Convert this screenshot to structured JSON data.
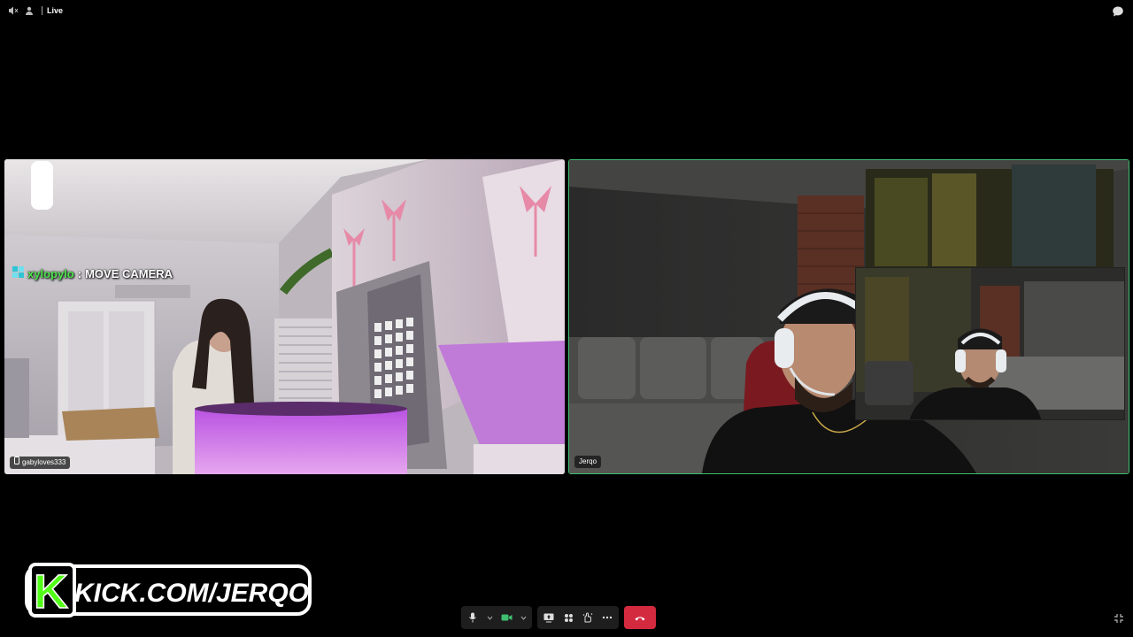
{
  "topbar": {
    "status": "Live",
    "icons": [
      "speaker-muted-icon",
      "people-icon",
      "chat-icon"
    ]
  },
  "participants": [
    {
      "name": "gabyloves333",
      "device": "phone-icon",
      "active_speaker": false
    },
    {
      "name": "Jerqo",
      "active_speaker": true
    }
  ],
  "chat_overlay": {
    "username": "xylopylo",
    "separator": ":",
    "message": "MOVE CAMERA"
  },
  "branding": {
    "logo_letter": "K",
    "logo_text": "KICK.COM/JERQO",
    "accent": "#53fc18"
  },
  "controls": {
    "icons": [
      "microphone-icon",
      "camera-icon",
      "share-screen-icon",
      "grid-view-icon",
      "reactions-icon",
      "more-icon",
      "leave-call-icon",
      "fullscreen-exit-icon"
    ]
  },
  "colors": {
    "active_border": "#3fbf6f",
    "leave_button": "#d42a3f",
    "camera_on": "#3fbf6f"
  }
}
